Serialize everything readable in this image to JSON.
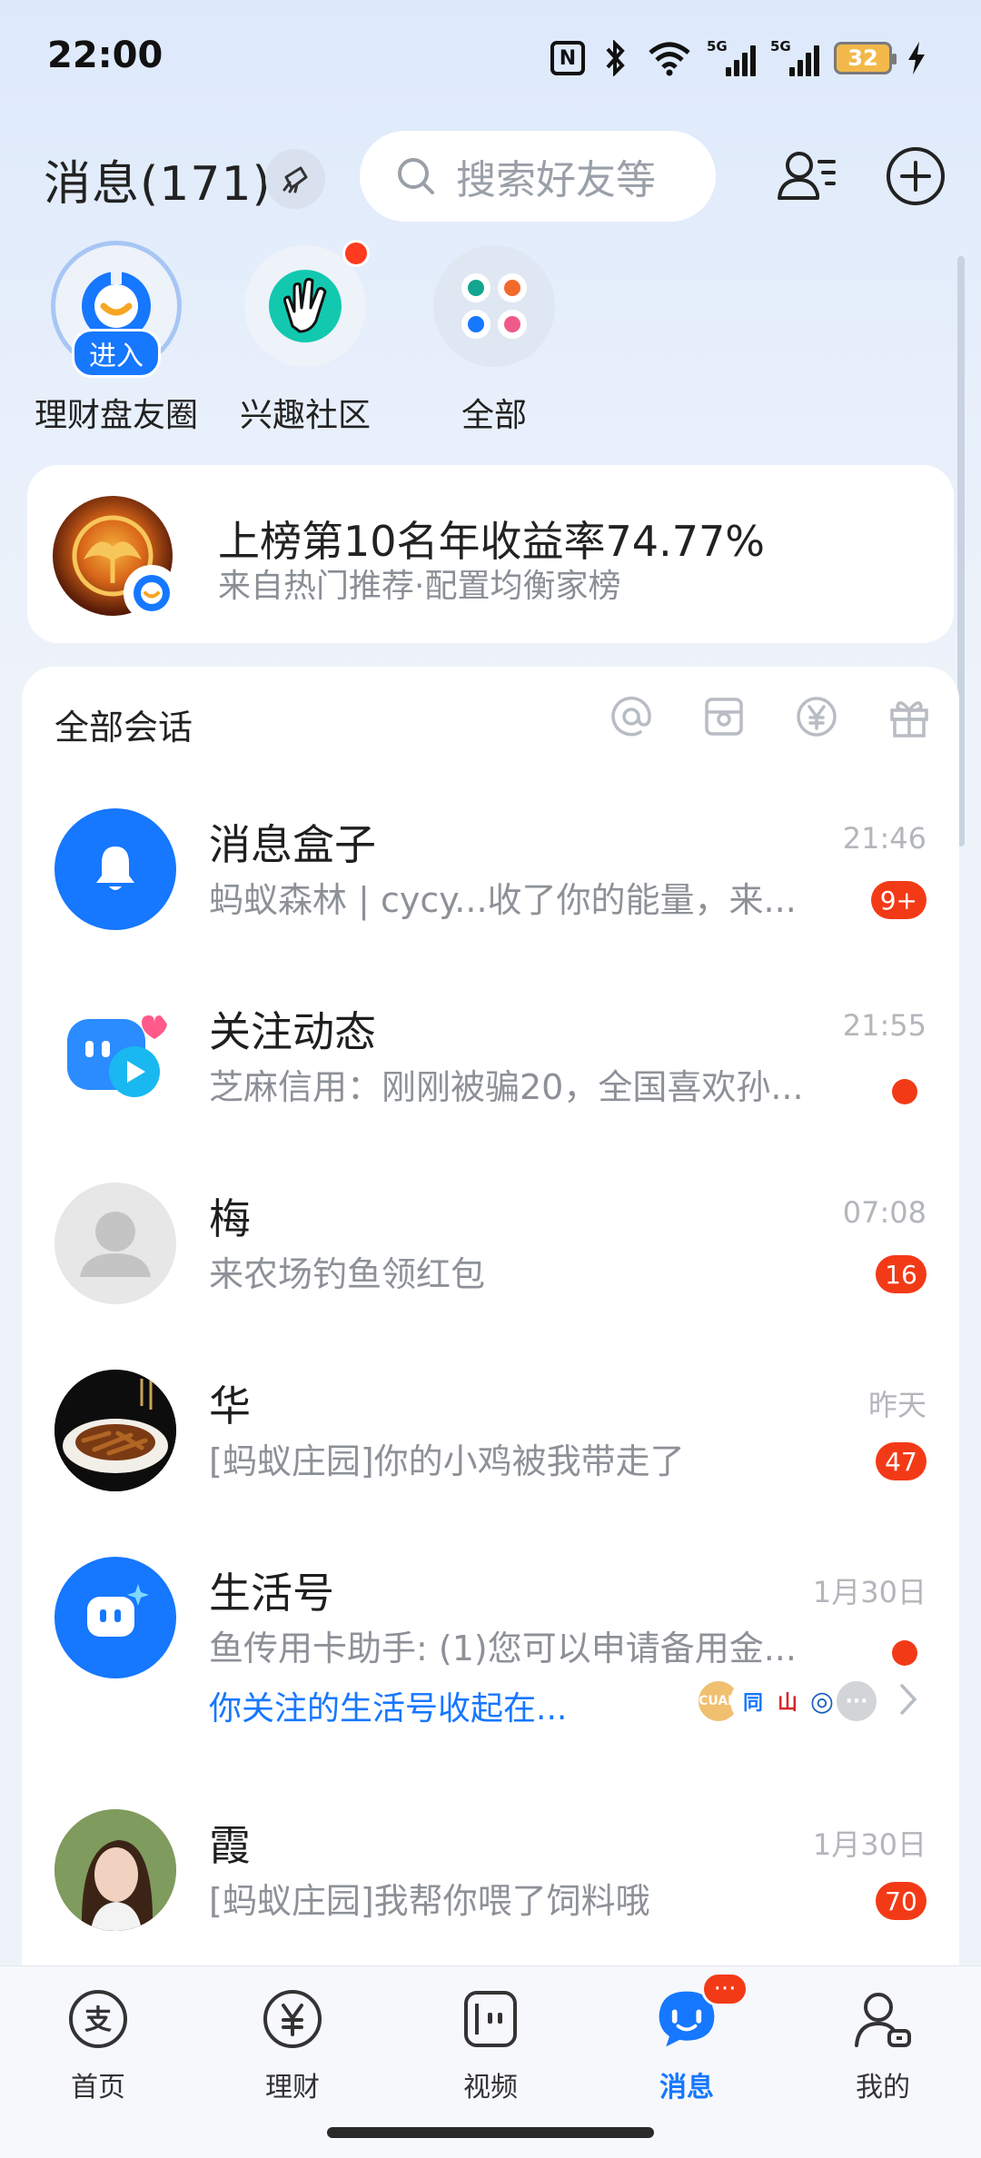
{
  "status_bar": {
    "time": "22:00",
    "nfc": "N",
    "network": "5G",
    "battery": "32"
  },
  "header": {
    "title": "消息(171)",
    "search_placeholder": "搜索好友等"
  },
  "quick_apps": [
    {
      "label": "理财盘友圈",
      "enter": "进入"
    },
    {
      "label": "兴趣社区"
    },
    {
      "label": "全部"
    }
  ],
  "promo": {
    "title": "上榜第10名年收益率74.77%",
    "subtitle": "来自热门推荐·配置均衡家榜"
  },
  "panel": {
    "title": "全部会话"
  },
  "conversations": [
    {
      "name": "消息盒子",
      "time": "21:46",
      "preview": "蚂蚁森林 | cycy...收了你的能量，来...",
      "badge": "9+"
    },
    {
      "name": "关注动态",
      "time": "21:55",
      "preview": "芝麻信用：刚刚被骗20，全国喜欢孙..."
    },
    {
      "name": "梅",
      "time": "07:08",
      "preview": "来农场钓鱼领红包",
      "badge": "16"
    },
    {
      "name": "华",
      "time": "昨天",
      "preview": "[蚂蚁庄园]你的小鸡被我带走了",
      "badge": "47"
    },
    {
      "name": "生活号",
      "time": "1月30日",
      "preview": "鱼传用卡助手: (1)您可以申请备用金...",
      "link": "你关注的生活号收起在...",
      "mini_icons": [
        "CUAN",
        "同",
        "山",
        "◎",
        "···"
      ]
    },
    {
      "name": "霞",
      "time": "1月30日",
      "preview": "[蚂蚁庄园]我帮你喂了饲料哦",
      "badge": "70"
    }
  ],
  "bottom_nav": [
    {
      "label": "首页"
    },
    {
      "label": "理财"
    },
    {
      "label": "视频"
    },
    {
      "label": "消息",
      "badge": "···"
    },
    {
      "label": "我的"
    }
  ],
  "colors": {
    "accent": "#1677ff",
    "badge": "#f33a17"
  }
}
